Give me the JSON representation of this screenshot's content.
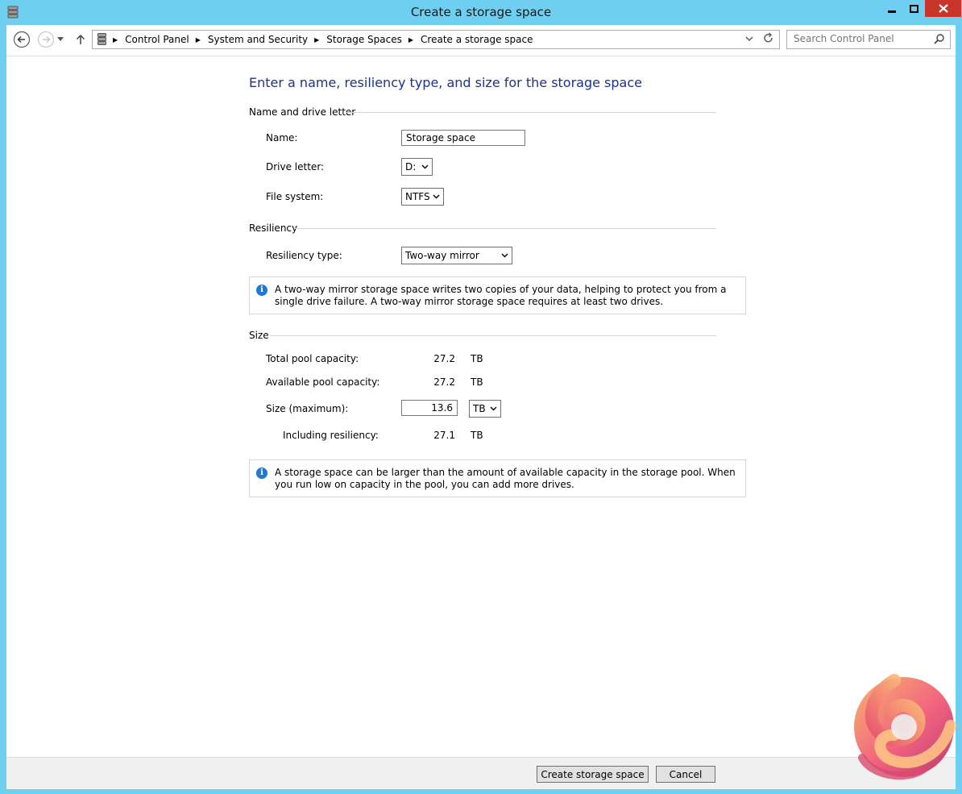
{
  "window": {
    "title": "Create a storage space"
  },
  "navigation": {
    "breadcrumbs": [
      "Control Panel",
      "System and Security",
      "Storage Spaces",
      "Create a storage space"
    ],
    "search_placeholder": "Search Control Panel"
  },
  "page": {
    "heading": "Enter a name, resiliency type, and size for the storage space"
  },
  "name_section": {
    "label": "Name and drive letter",
    "name_label": "Name:",
    "name_value": "Storage space",
    "drive_label": "Drive letter:",
    "drive_value": "D:",
    "fs_label": "File system:",
    "fs_value": "NTFS"
  },
  "resiliency_section": {
    "label": "Resiliency",
    "type_label": "Resiliency type:",
    "type_value": "Two-way mirror",
    "info": "A two-way mirror storage space writes two copies of your data, helping to protect you from a single drive failure. A two-way mirror storage space requires at least two drives."
  },
  "size_section": {
    "label": "Size",
    "total_label": "Total pool capacity:",
    "total_value": "27.2",
    "total_unit": "TB",
    "available_label": "Available pool capacity:",
    "available_value": "27.2",
    "available_unit": "TB",
    "size_label": "Size (maximum):",
    "size_value": "13.6",
    "size_unit": "TB",
    "including_label": "Including resiliency:",
    "including_value": "27.1",
    "including_unit": "TB",
    "info": "A storage space can be larger than the amount of available capacity in the storage pool. When you run low on capacity in the pool, you can add more drives."
  },
  "footer": {
    "create_label": "Create storage space",
    "cancel_label": "Cancel"
  },
  "colors": {
    "title_bar": "#6ecff0",
    "heading": "#1e3287",
    "close_button": "#c7352b",
    "info_icon": "#1f78d1"
  }
}
